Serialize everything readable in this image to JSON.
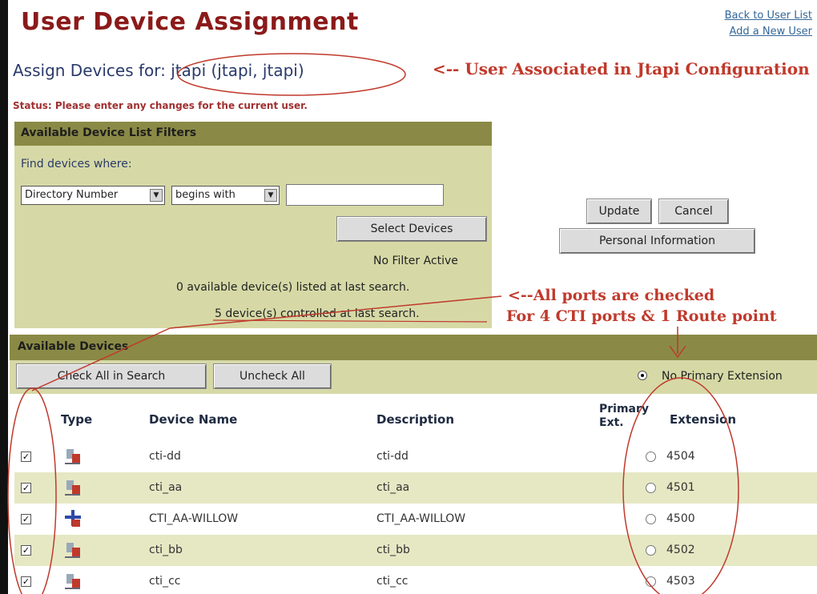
{
  "top_strip": "",
  "page_title": "User Device Assignment",
  "links": {
    "back": "Back to User List",
    "add": "Add a New User"
  },
  "assign_heading": {
    "prefix": "Assign Devices for: ",
    "user": "jtapi (jtapi, jtapi)"
  },
  "annotations": {
    "user": "<-- User Associated in Jtapi Configuration",
    "ports_line1": "<--All ports are checked",
    "ports_line2": "For 4 CTI ports & 1 Route point"
  },
  "status": "Status: Please enter any changes for the current user.",
  "filters": {
    "title": "Available Device List Filters",
    "find_label": "Find devices where:",
    "field_select": "Directory Number",
    "match_select": "begins with",
    "search_value": "",
    "select_button": "Select Devices",
    "no_filter": "No Filter Active",
    "available_listed": "0 available device(s) listed at last search.",
    "controlled": "5 device(s) controlled at last search."
  },
  "actions": {
    "update": "Update",
    "cancel": "Cancel",
    "personal": "Personal Information"
  },
  "devices": {
    "title": "Available Devices",
    "check_all": "Check All in Search",
    "uncheck_all": "Uncheck All",
    "no_primary": "No Primary Extension",
    "columns": {
      "type": "Type",
      "device_name": "Device Name",
      "description": "Description",
      "primary_ext": "Primary Ext.",
      "extension": "Extension"
    },
    "rows": [
      {
        "checked": true,
        "icon": "cti-port-icon",
        "device_name": "cti-dd",
        "description": "cti-dd",
        "extension": "4504"
      },
      {
        "checked": true,
        "icon": "cti-port-icon",
        "device_name": "cti_aa",
        "description": "cti_aa",
        "extension": "4501"
      },
      {
        "checked": true,
        "icon": "route-point-icon",
        "device_name": "CTI_AA-WILLOW",
        "description": "CTI_AA-WILLOW",
        "extension": "4500"
      },
      {
        "checked": true,
        "icon": "cti-port-icon",
        "device_name": "cti_bb",
        "description": "cti_bb",
        "extension": "4502"
      },
      {
        "checked": true,
        "icon": "cti-port-icon",
        "device_name": "cti_cc",
        "description": "cti_cc",
        "extension": "4503"
      }
    ]
  },
  "colors": {
    "title": "#8b1a1a",
    "annotation": "#c0392b",
    "panel_header": "#8a8a46",
    "panel_body": "#d6d9a6",
    "row_shade": "#e6e8c4"
  }
}
